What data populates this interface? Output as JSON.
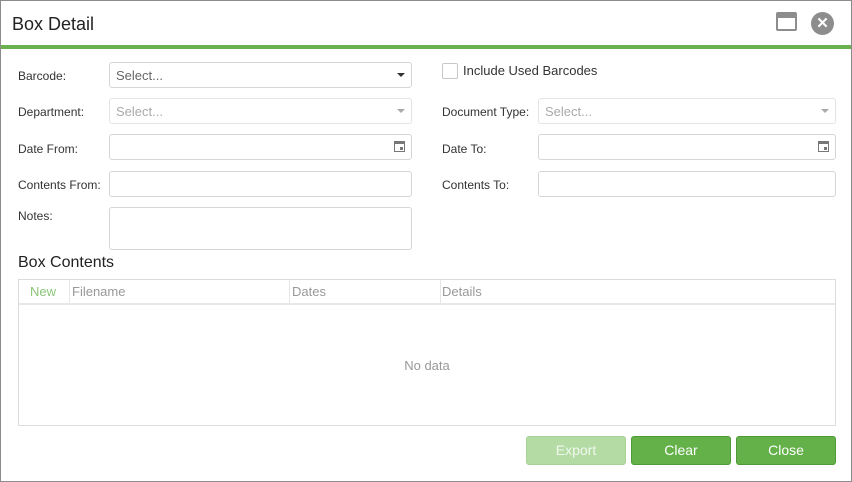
{
  "window": {
    "title": "Box Detail"
  },
  "form": {
    "barcode_label": "Barcode:",
    "barcode_placeholder": "Select...",
    "include_used_label": "Include Used Barcodes",
    "department_label": "Department:",
    "department_placeholder": "Select...",
    "document_type_label": "Document Type:",
    "document_type_placeholder": "Select...",
    "date_from_label": "Date From:",
    "date_to_label": "Date To:",
    "contents_from_label": "Contents From:",
    "contents_to_label": "Contents To:",
    "notes_label": "Notes:"
  },
  "contents": {
    "title": "Box Contents",
    "columns": [
      "New",
      "Filename",
      "Dates",
      "Details"
    ],
    "empty_text": "No data"
  },
  "buttons": {
    "export": "Export",
    "clear": "Clear",
    "close": "Close"
  },
  "colors": {
    "accent": "#6ab04c",
    "button": "#64b14a",
    "button_disabled": "#b4dba4"
  }
}
